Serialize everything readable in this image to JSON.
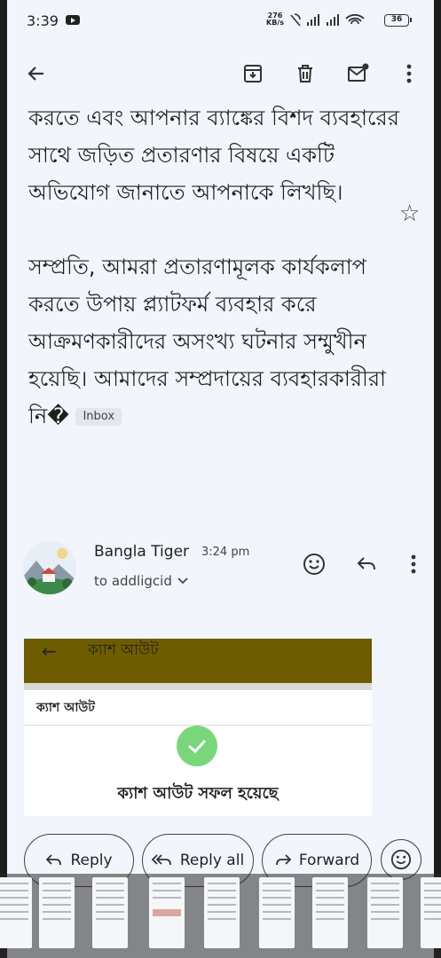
{
  "status": {
    "time": "3:39",
    "net_speed_value": "276",
    "net_speed_unit": "KB/s",
    "battery": "36"
  },
  "toolbar": {
    "icons": [
      "back-arrow-icon",
      "archive-icon",
      "delete-icon",
      "mark-unread-icon",
      "more-vert-icon"
    ]
  },
  "message": {
    "body_lines": [
      "করতে এবং আপনার ব্যাঙ্কের বিশদ ব্যবহারের সাথে জড়িত প্রতারণার বিষয়ে একটি অভিযোগ জানাতে আপনাকে লিখছি।",
      "সম্প্রতি, আমরা প্রতারণামূলক কার্যকলাপ করতে উপায় প্ল্যাটফর্ম ব্যবহার করে আক্রমণকারীদের অসংখ্য ঘটনার সম্মুখীন হয়েছি। আমাদের সম্প্রদায়ের ব্যবহারকারীরা নি�"
    ],
    "label_chip": "Inbox"
  },
  "sender": {
    "name": "Bangla Tiger",
    "time": "3:24 pm",
    "to": "to addligcid"
  },
  "attachment": {
    "header_title": "ক্যাশ আউট",
    "sub_title": "ক্যাশ আউট",
    "success_text": "ক্যাশ আউট সফল হয়েছে"
  },
  "actions": {
    "reply": "Reply",
    "reply_all": "Reply all",
    "forward": "Forward"
  },
  "colors": {
    "background": "#f2f6fc",
    "attachment_header": "#6e5c00",
    "success_green": "#7ad67a"
  }
}
